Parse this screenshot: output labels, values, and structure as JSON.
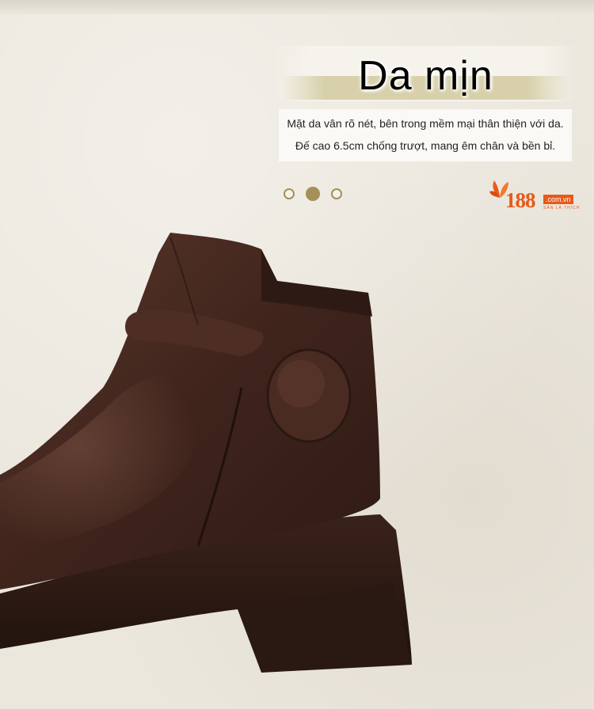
{
  "banner": {
    "title": "Da mịn",
    "line1": "Mặt da vân rõ nét, bên trong mềm mại thân thiện với da.",
    "line2": "Đế cao 6.5cm chống trượt, mang êm chân và bền bỉ."
  },
  "carousel": {
    "dots": 3,
    "active_index": 1,
    "accent": "#a3905a"
  },
  "logo": {
    "number": "188",
    "domain": ".com.vn",
    "tagline": "SÀN LÀ THÍCH",
    "color": "#e8591a"
  },
  "product": {
    "icon": "leather-ankle-boot-photo",
    "leather_color": "#4a2b22"
  }
}
